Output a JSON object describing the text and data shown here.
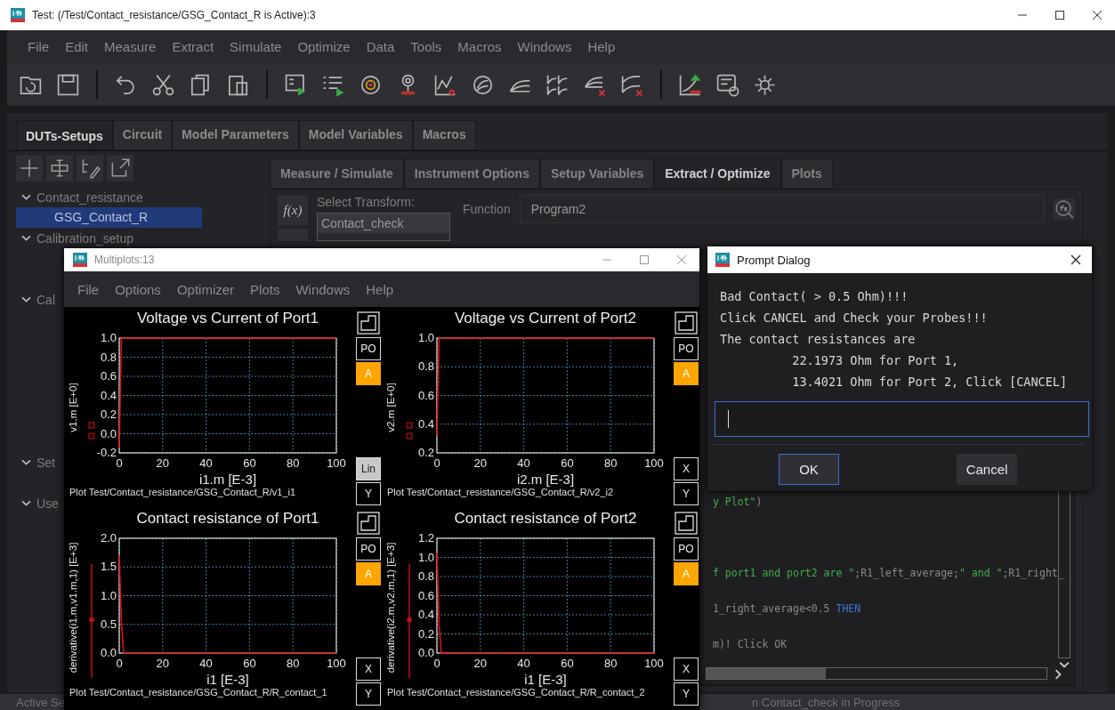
{
  "window": {
    "title": "Test: (/Test/Contact_resistance/GSG_Contact_R is Active):3"
  },
  "menu": [
    "File",
    "Edit",
    "Measure",
    "Extract",
    "Simulate",
    "Optimize",
    "Data",
    "Tools",
    "Macros",
    "Windows",
    "Help"
  ],
  "main_tabs": [
    {
      "label": "DUTs-Setups",
      "selected": true
    },
    {
      "label": "Circuit",
      "selected": false
    },
    {
      "label": "Model Parameters",
      "selected": false
    },
    {
      "label": "Model Variables",
      "selected": false
    },
    {
      "label": "Macros",
      "selected": false
    }
  ],
  "tree": [
    {
      "label": "Contact_resistance",
      "expanded": true,
      "selected": false,
      "children": [
        {
          "label": "GSG_Contact_R",
          "selected": true
        }
      ]
    },
    {
      "label": "Calibration_setup",
      "expanded": true,
      "selected": false
    },
    {
      "label": "Cal",
      "expanded": true,
      "selected": false
    },
    {
      "label": "Set",
      "expanded": true,
      "selected": false
    },
    {
      "label": "Use",
      "expanded": true,
      "selected": false
    }
  ],
  "setup_tabs": [
    {
      "label": "Measure / Simulate",
      "selected": false
    },
    {
      "label": "Instrument Options",
      "selected": false
    },
    {
      "label": "Setup Variables",
      "selected": false
    },
    {
      "label": "Extract / Optimize",
      "selected": true
    },
    {
      "label": "Plots",
      "selected": false
    }
  ],
  "transform": {
    "run_button": "f(x)",
    "label": "Select Transform:",
    "items": [
      {
        "label": "Contact_check",
        "selected": true
      }
    ],
    "function_label": "Function",
    "function_value": "Program2"
  },
  "code_lines": [
    [
      {
        "text": "y Plot\"",
        "kind": "string"
      },
      {
        "text": ")",
        "kind": "plain"
      }
    ],
    [
      {
        "text": "f port1 and port2 are \"",
        "kind": "string"
      },
      {
        "text": ";R1_left_average;",
        "kind": "plain"
      },
      {
        "text": "\" and \"",
        "kind": "string"
      },
      {
        "text": ";R1_right_",
        "kind": "plain"
      }
    ],
    [
      {
        "text": "1_right_average<0.5 ",
        "kind": "plain"
      },
      {
        "text": "THEN",
        "kind": "keyword"
      }
    ],
    [
      {
        "text": "m)! Click OK",
        "kind": "plain"
      }
    ]
  ],
  "status_bar": [
    "Active Se",
    "n Contact_check in Progress"
  ],
  "multiplots": {
    "title": "Multiplots:13",
    "menu": [
      "File",
      "Options",
      "Optimizer",
      "Plots",
      "Windows",
      "Help"
    ],
    "plots": [
      {
        "caption": "Plot Test/Contact_resistance/GSG_Contact_R/v1_i1",
        "buttons": [
          {
            "label": "PO",
            "on": false
          },
          {
            "label": "A",
            "on": true
          }
        ],
        "axis_buttons": [
          {
            "label": "Lin",
            "selected": true
          },
          {
            "label": "Y",
            "selected": false
          }
        ],
        "chart_data": {
          "type": "line",
          "title": "Voltage vs Current of Port1",
          "xlabel": "i1.m  [E-3]",
          "ylabel": "v1.m  [E+0]",
          "x": [
            0,
            1,
            100
          ],
          "grid": true,
          "series": [
            {
              "color": "#e01010",
              "values": [
                -0.15,
                1.0,
                1.0
              ]
            }
          ],
          "xlim": [
            0,
            100
          ],
          "ylim": [
            -0.2,
            1.0
          ],
          "xticks": [
            0,
            20,
            40,
            60,
            80,
            100
          ],
          "yticks": [
            {
              "value": -0.2,
              "label": "-0.2"
            },
            {
              "value": 0,
              "label": "0.0"
            },
            {
              "value": 0.2,
              "label": "0.2"
            },
            {
              "value": 0.4,
              "label": "0.4"
            },
            {
              "value": 0.6,
              "label": "0.6"
            },
            {
              "value": 0.8,
              "label": "0.8"
            },
            {
              "value": 1,
              "label": "1.0"
            }
          ]
        }
      },
      {
        "caption": "Plot Test/Contact_resistance/GSG_Contact_R/v2_i2",
        "buttons": [
          {
            "label": "PO",
            "on": false
          },
          {
            "label": "A",
            "on": true
          }
        ],
        "axis_buttons": [
          {
            "label": "X",
            "selected": false
          },
          {
            "label": "Y",
            "selected": false
          }
        ],
        "chart_data": {
          "type": "line",
          "title": "Voltage vs Current of Port2",
          "xlabel": "i2.m  [E-3]",
          "ylabel": "v2.m  [E+0]",
          "x": [
            0,
            1,
            100
          ],
          "grid": true,
          "series": [
            {
              "color": "#e01010",
              "values": [
                0.32,
                1.0,
                1.0
              ]
            }
          ],
          "xlim": [
            0,
            100
          ],
          "ylim": [
            0.2,
            1.0
          ],
          "xticks": [
            0,
            20,
            40,
            60,
            80,
            100
          ],
          "yticks": [
            {
              "value": 0.2,
              "label": "0.2"
            },
            {
              "value": 0.4,
              "label": "0.4"
            },
            {
              "value": 0.6,
              "label": "0.6"
            },
            {
              "value": 0.8,
              "label": "0.8"
            },
            {
              "value": 1,
              "label": "1.0"
            }
          ]
        }
      },
      {
        "caption": "Plot Test/Contact_resistance/GSG_Contact_R/R_contact_1",
        "buttons": [
          {
            "label": "PO",
            "on": false
          },
          {
            "label": "A",
            "on": true
          }
        ],
        "axis_buttons": [
          {
            "label": "X",
            "selected": false
          },
          {
            "label": "Y",
            "selected": false
          }
        ],
        "chart_data": {
          "type": "line",
          "title": "Contact resistance of Port1",
          "xlabel": "i1  [E-3]",
          "ylabel": "derivative(i1.m,v1.m,1)  [E+3]",
          "x": [
            0,
            1,
            2,
            100
          ],
          "grid": true,
          "series": [
            {
              "color": "#e01010",
              "values": [
                1.7,
                0.55,
                0,
                0
              ]
            }
          ],
          "xlim": [
            0,
            100
          ],
          "ylim": [
            0,
            2
          ],
          "xticks": [
            0,
            20,
            40,
            60,
            80,
            100
          ],
          "yticks": [
            {
              "value": 0,
              "label": "0.0"
            },
            {
              "value": 0.5,
              "label": "0.5"
            },
            {
              "value": 1,
              "label": "1.0"
            },
            {
              "value": 1.5,
              "label": "1.5"
            },
            {
              "value": 2,
              "label": "2.0"
            }
          ]
        }
      },
      {
        "caption": "Plot Test/Contact_resistance/GSG_Contact_R/R_contact_2",
        "buttons": [
          {
            "label": "PO",
            "on": false
          },
          {
            "label": "A",
            "on": true
          }
        ],
        "axis_buttons": [
          {
            "label": "X",
            "selected": false
          },
          {
            "label": "Y",
            "selected": false
          }
        ],
        "chart_data": {
          "type": "line",
          "title": "Contact resistance of Port2",
          "xlabel": "i1  [E-3]",
          "ylabel": "derivative(i2.m,v2.m,1)  [E+3]",
          "x": [
            0,
            1,
            2,
            100
          ],
          "grid": true,
          "series": [
            {
              "color": "#e01010",
              "values": [
                1.05,
                0.3,
                0,
                0
              ]
            }
          ],
          "xlim": [
            0,
            100
          ],
          "ylim": [
            0,
            1.2
          ],
          "xticks": [
            0,
            20,
            40,
            60,
            80,
            100
          ],
          "yticks": [
            {
              "value": 0,
              "label": "0.0"
            },
            {
              "value": 0.2,
              "label": "0.2"
            },
            {
              "value": 0.4,
              "label": "0.4"
            },
            {
              "value": 0.6,
              "label": "0.6"
            },
            {
              "value": 0.8,
              "label": "0.8"
            },
            {
              "value": 1,
              "label": "1.0"
            },
            {
              "value": 1.2,
              "label": "1.2"
            }
          ]
        }
      }
    ]
  },
  "dialog": {
    "title": "Prompt Dialog",
    "lines": [
      "Bad Contact( > 0.5 Ohm)!!!",
      "Click CANCEL and Check your Probes!!!",
      "The contact resistances are",
      "          22.1973 Ohm for Port 1,",
      "          13.4021 Ohm for Port 2, Click [CANCEL]"
    ],
    "buttons": [
      {
        "label": "OK",
        "kind": "default"
      },
      {
        "label": "Cancel",
        "kind": "plain"
      }
    ]
  }
}
